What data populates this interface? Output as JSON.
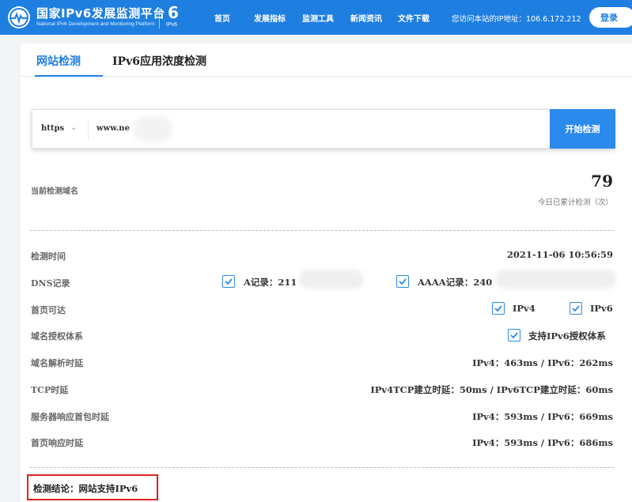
{
  "header": {
    "site_title": "国家IPv6发展监测平台",
    "site_subtitle": "National IPv6 Development and Monitoring Platform",
    "ipv6_logo_text": "IPv6",
    "logo_icon": "pulse-globe-icon",
    "nav": [
      "首页",
      "发展指标",
      "监测工具",
      "新闻资讯",
      "文件下载"
    ],
    "ip_info": "您访问本站的IP地址：106.6.172.212",
    "login_label": "登录"
  },
  "tabs": {
    "active": "网站检测",
    "inactive": "IPv6应用浓度检测"
  },
  "search": {
    "protocol": "https",
    "url_value": "www.ne",
    "button_label": "开始检测",
    "chevron_icon": "chevron-down-icon"
  },
  "summary": {
    "domain_label": "当前检测域名",
    "count": "79",
    "count_label": "今日已累计检测（次）"
  },
  "results": {
    "time_label": "检测时间",
    "time_value": "2021-11-06 10:56:59",
    "dns_label": "DNS记录",
    "dns_a": "A记录：211",
    "dns_aaaa": "AAAA记录：240",
    "home_label": "首页可达",
    "home_ipv4": "IPv4",
    "home_ipv6": "IPv6",
    "auth_label": "域名授权体系",
    "auth_value": "支持IPv6授权体系",
    "resolve_label": "域名解析时延",
    "resolve_value": "IPv4：463ms / IPv6：262ms",
    "tcp_label": "TCP时延",
    "tcp_value": "IPv4TCP建立时延：50ms / IPv6TCP建立时延：60ms",
    "first_packet_label": "服务器响应首包时延",
    "first_packet_value": "IPv4：593ms / IPv6：669ms",
    "page_label": "首页响应时延",
    "page_value": "IPv4：593ms / IPv6：686ms"
  },
  "conclusion": "检测结论：网站支持IPv6",
  "colors": {
    "primary": "#1f7fe0",
    "button": "#2b8aec",
    "highlight_border": "#e02020"
  }
}
